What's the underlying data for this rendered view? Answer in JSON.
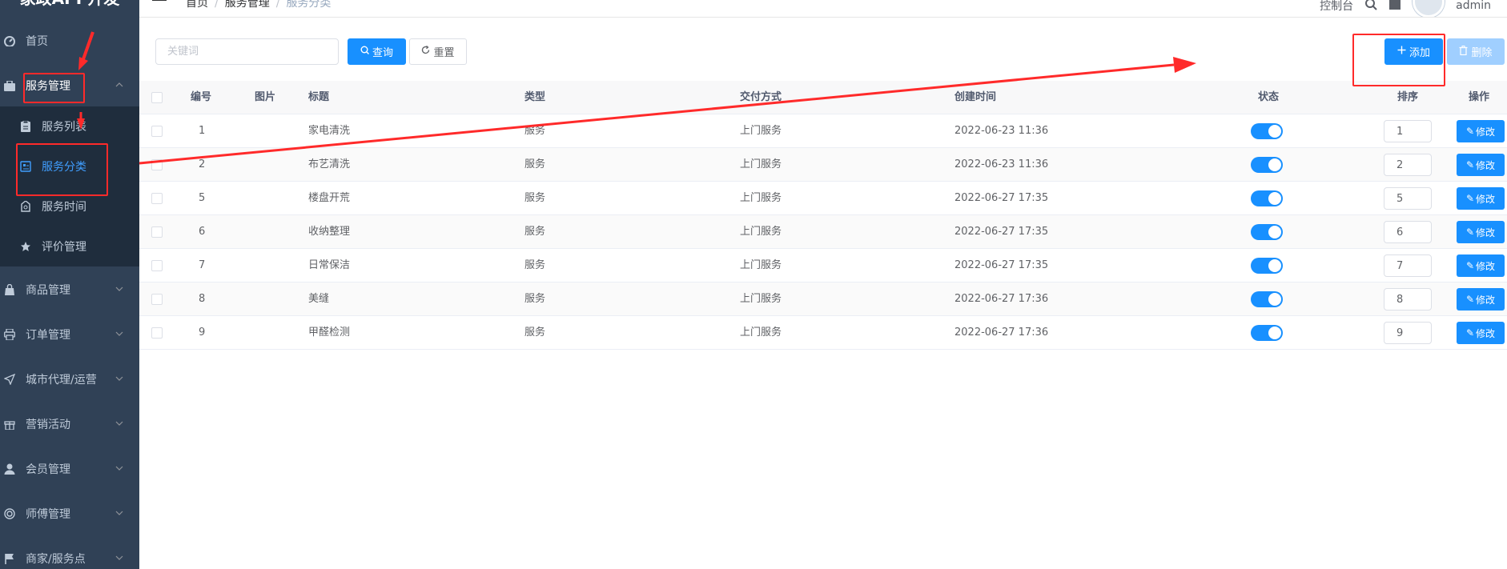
{
  "sidebar": {
    "brand": "家政APP开发",
    "items": [
      {
        "label": "首页",
        "icon": "dashboard-icon"
      },
      {
        "label": "服务管理",
        "icon": "briefcase-icon"
      },
      {
        "label": "商品管理",
        "icon": "shopping-bag-icon"
      },
      {
        "label": "订单管理",
        "icon": "printer-icon"
      },
      {
        "label": "城市代理/运营",
        "icon": "navigation-icon"
      },
      {
        "label": "营销活动",
        "icon": "gift-icon"
      },
      {
        "label": "会员管理",
        "icon": "user-icon"
      },
      {
        "label": "师傅管理",
        "icon": "support-icon"
      },
      {
        "label": "商家/服务点",
        "icon": "flag-icon"
      }
    ],
    "submenu": [
      {
        "label": "服务列表",
        "icon": "clipboard-icon"
      },
      {
        "label": "服务分类",
        "icon": "category-icon"
      },
      {
        "label": "服务时间",
        "icon": "clock-tag-icon"
      },
      {
        "label": "评价管理",
        "icon": "star-icon"
      }
    ]
  },
  "header": {
    "breadcrumb": [
      "首页",
      "服务管理",
      "服务分类"
    ],
    "right_text": "控制台",
    "username": "admin"
  },
  "search": {
    "placeholder": "关键词",
    "query_label": "查询",
    "reset_label": "重置"
  },
  "toolbar": {
    "add_label": "添加",
    "delete_label": "删除"
  },
  "table": {
    "columns": [
      "编号",
      "图片",
      "标题",
      "类型",
      "交付方式",
      "创建时间",
      "状态",
      "排序",
      "操作"
    ],
    "edit_label": "修改",
    "rows": [
      {
        "id": "1",
        "title": "家电清洗",
        "type": "服务",
        "delivery": "上门服务",
        "created": "2022-06-23 11:36",
        "status": true,
        "sort": "1"
      },
      {
        "id": "2",
        "title": "布艺清洗",
        "type": "服务",
        "delivery": "上门服务",
        "created": "2022-06-23 11:36",
        "status": true,
        "sort": "2"
      },
      {
        "id": "5",
        "title": "楼盘开荒",
        "type": "服务",
        "delivery": "上门服务",
        "created": "2022-06-27 17:35",
        "status": true,
        "sort": "5"
      },
      {
        "id": "6",
        "title": "收纳整理",
        "type": "服务",
        "delivery": "上门服务",
        "created": "2022-06-27 17:35",
        "status": true,
        "sort": "6"
      },
      {
        "id": "7",
        "title": "日常保洁",
        "type": "服务",
        "delivery": "上门服务",
        "created": "2022-06-27 17:35",
        "status": true,
        "sort": "7"
      },
      {
        "id": "8",
        "title": "美缝",
        "type": "服务",
        "delivery": "上门服务",
        "created": "2022-06-27 17:36",
        "status": true,
        "sort": "8"
      },
      {
        "id": "9",
        "title": "甲醛检测",
        "type": "服务",
        "delivery": "上门服务",
        "created": "2022-06-27 17:36",
        "status": true,
        "sort": "9"
      }
    ]
  },
  "colors": {
    "sidebar_bg": "#304156",
    "submenu_bg": "#1f2d3d",
    "primary": "#1890ff",
    "annotation": "#ff2a2a"
  }
}
